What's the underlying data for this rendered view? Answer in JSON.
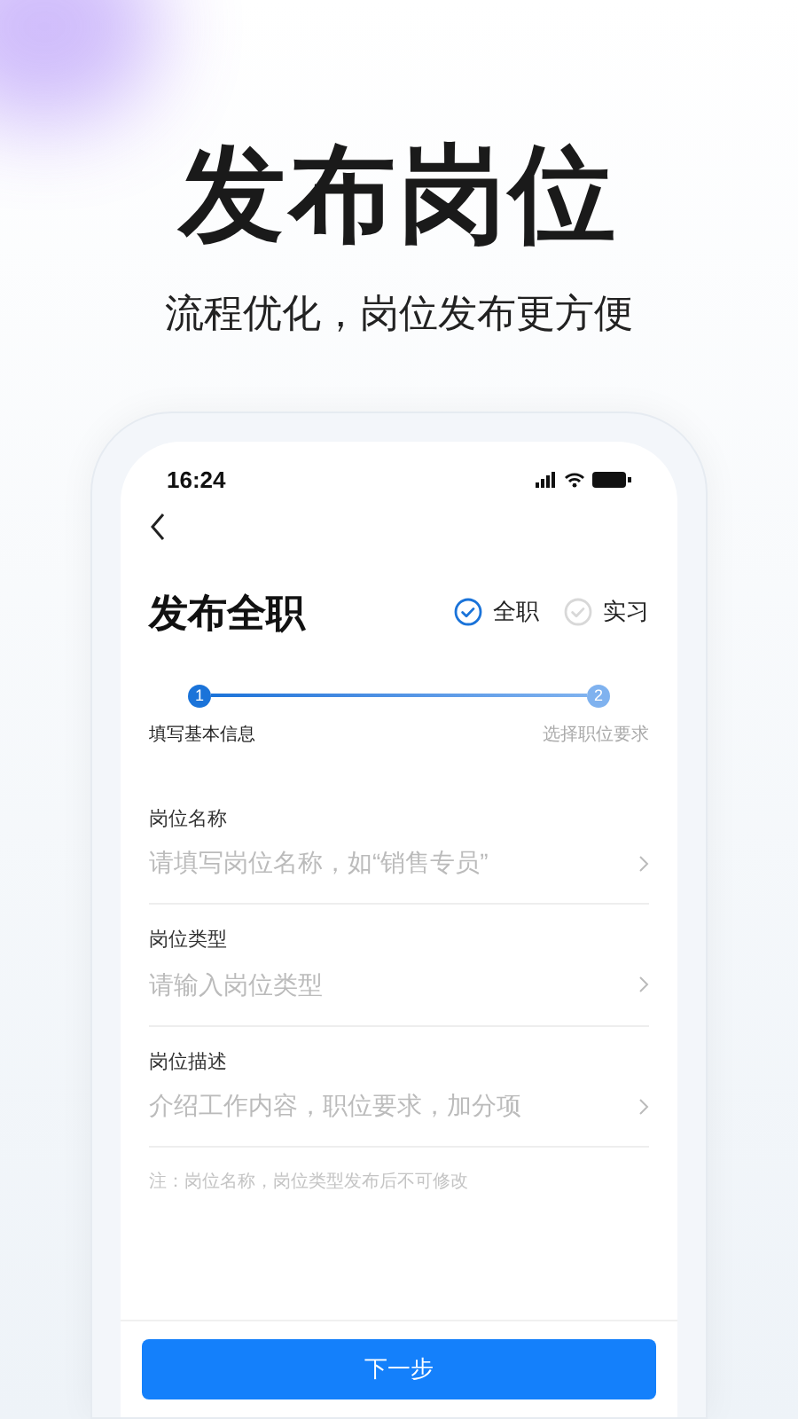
{
  "headline": "发布岗位",
  "subtitle": "流程优化，岗位发布更方便",
  "status_bar": {
    "time": "16:24"
  },
  "page_title": "发布全职",
  "job_types": [
    {
      "label": "全职",
      "selected": true
    },
    {
      "label": "实习",
      "selected": false
    }
  ],
  "steps": [
    {
      "number": "1",
      "label": "填写基本信息",
      "selected": true
    },
    {
      "number": "2",
      "label": "选择职位要求",
      "selected": false
    }
  ],
  "fields": [
    {
      "label": "岗位名称",
      "placeholder": "请填写岗位名称，如“销售专员”"
    },
    {
      "label": "岗位类型",
      "placeholder": "请输入岗位类型"
    },
    {
      "label": "岗位描述",
      "placeholder": "介绍工作内容，职位要求，加分项"
    }
  ],
  "note": "注：岗位名称，岗位类型发布后不可修改",
  "next_button": "下一步"
}
